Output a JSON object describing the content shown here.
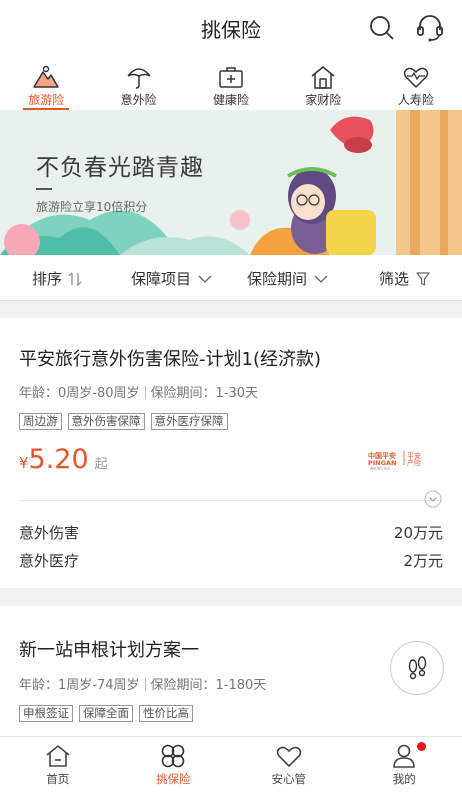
{
  "header": {
    "title": "挑保险"
  },
  "categories": [
    {
      "label": "旅游险",
      "icon": "mountain-icon",
      "active": true
    },
    {
      "label": "意外险",
      "icon": "umbrella-icon"
    },
    {
      "label": "健康险",
      "icon": "medical-kit-icon"
    },
    {
      "label": "家财险",
      "icon": "house-icon"
    },
    {
      "label": "人寿险",
      "icon": "heartbeat-icon"
    }
  ],
  "banner": {
    "title": "不负春光踏青趣",
    "subtitle": "旅游险立享10倍积分"
  },
  "filters": {
    "sort": "排序",
    "coverage": "保障项目",
    "period": "保险期间",
    "filter": "筛选"
  },
  "products": [
    {
      "title": "平安旅行意外伤害保险-计划1(经济款)",
      "age": "年龄：0周岁-80周岁",
      "period": "保险期间：1-30天",
      "tags": [
        "周边游",
        "意外伤害保障",
        "意外医疗保障"
      ],
      "currency": "¥",
      "price": "5.20",
      "price_suffix": "起",
      "brand": {
        "line1": "中国平安",
        "line2": "PINGAN",
        "line3": "平安",
        "line4": "产险",
        "slogan": "保险·银行·投资"
      },
      "coverages": [
        {
          "name": "意外伤害",
          "amount": "20万元"
        },
        {
          "name": "意外医疗",
          "amount": "2万元"
        }
      ]
    },
    {
      "title": "新一站申根计划方案一",
      "age": "年龄：1周岁-74周岁",
      "period": "保险期间：1-180天",
      "tags": [
        "申根签证",
        "保障全面",
        "性价比高"
      ]
    }
  ],
  "tabbar": [
    {
      "label": "首页",
      "icon": "home-icon"
    },
    {
      "label": "挑保险",
      "icon": "clover-icon",
      "active": true
    },
    {
      "label": "安心管",
      "icon": "heart-icon"
    },
    {
      "label": "我的",
      "icon": "user-icon"
    }
  ],
  "colors": {
    "accent": "#e8552a",
    "badge": "#e8131d"
  }
}
